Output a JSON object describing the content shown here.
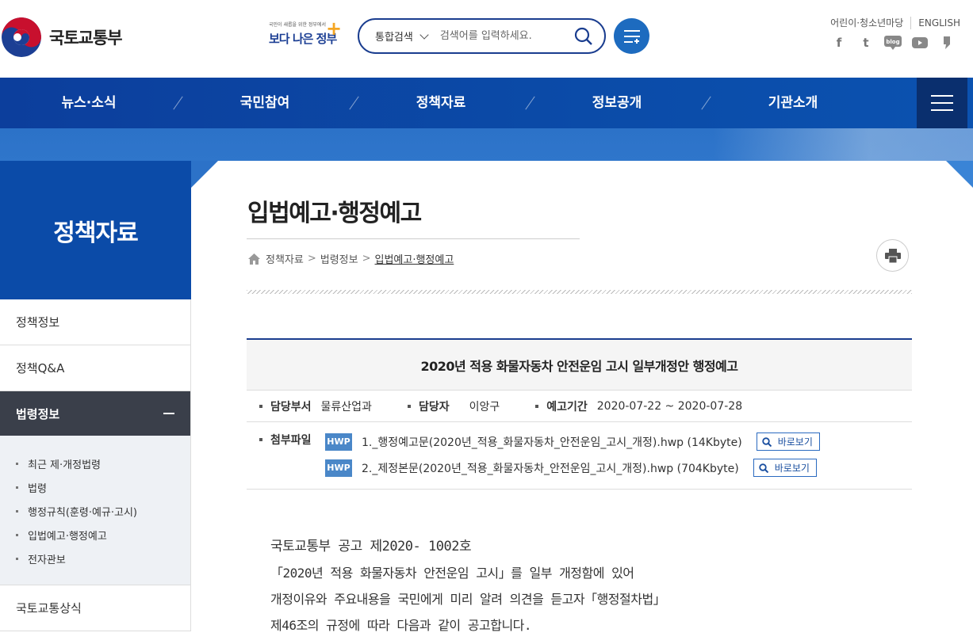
{
  "header": {
    "logo_text": "국토교통부",
    "gov_slogan_small": "국민이 새롭을 위한 정부에서",
    "gov_slogan": "보다 나은 정부",
    "search": {
      "scope": "통합검색",
      "placeholder": "검색어를 입력하세요."
    },
    "top_links": [
      "어린이·청소년마당",
      "ENGLISH"
    ],
    "sns": [
      "facebook-icon",
      "twitter-icon",
      "blog-icon",
      "youtube-icon",
      "kakao-icon"
    ],
    "sns_blog": "blog"
  },
  "nav": {
    "items": [
      "뉴스·소식",
      "국민참여",
      "정책자료",
      "정보공개",
      "기관소개"
    ]
  },
  "sidebar": {
    "title": "정책자료",
    "items": [
      "정책정보",
      "정책Q&A",
      "법령정보",
      "국토교통상식"
    ],
    "sub_items": [
      "최근 제·개정법령",
      "법령",
      "행정규칙(훈령·예규·고시)",
      "입법예고·행정예고",
      "전자관보"
    ]
  },
  "page": {
    "title": "입법예고·행정예고",
    "breadcrumb": [
      "정책자료",
      "법령정보",
      "입법예고·행정예고"
    ]
  },
  "post": {
    "title": "2020년 적용 화물자동차 안전운임 고시 일부개정안 행정예고",
    "dept_label": "담당부서",
    "dept": "물류산업과",
    "person_label": "담당자",
    "person": "이앙구",
    "period_label": "예고기간",
    "period": "2020-07-22 ~ 2020-07-28",
    "files_label": "첨부파일",
    "file_type": "HWP",
    "view_label": "바로보기",
    "files": [
      "1._행정예고문(2020년_적용_화물자동차_안전운임_고시_개정).hwp (14Kbyte)",
      "2._제정본문(2020년_적용_화물자동차_안전운임_고시_개정).hwp (704Kbyte)"
    ],
    "body": [
      "국토교통부 공고 제2020- 1002호",
      "「2020년 적용 화물자동차 안전운임 고시」를 일부 개정함에 있어",
      "개정이유와 주요내용을 국민에게 미리 알려 의견을 듣고자「행정절차법」",
      "제46조의 규정에 따라 다음과 같이 공고합니다."
    ]
  }
}
